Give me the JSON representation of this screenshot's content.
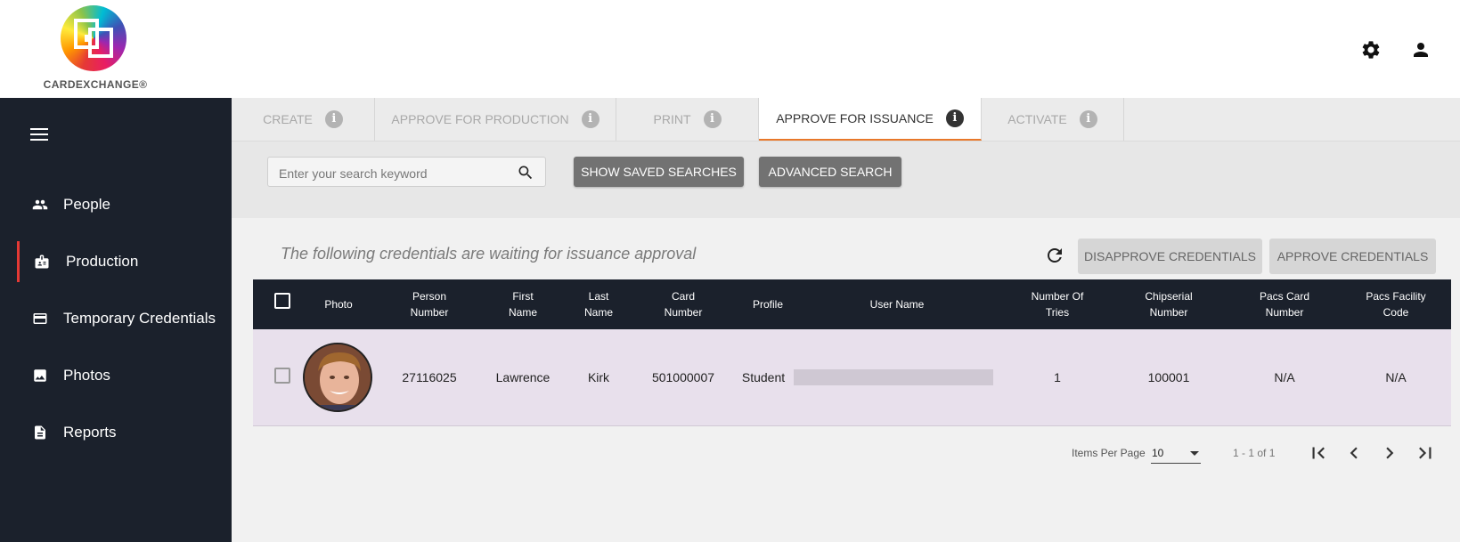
{
  "header": {
    "logo_text": "CARDEXCHANGE®",
    "settings_icon": "gear-icon",
    "account_icon": "person-icon"
  },
  "sidebar": {
    "menu_icon": "hamburger-icon",
    "items": [
      {
        "label": "People",
        "icon": "people-icon"
      },
      {
        "label": "Production",
        "icon": "badge-icon",
        "active": true
      },
      {
        "label": "Temporary Credentials",
        "icon": "card-icon"
      },
      {
        "label": "Photos",
        "icon": "image-icon"
      },
      {
        "label": "Reports",
        "icon": "document-icon"
      }
    ],
    "active_color": "#e53935"
  },
  "tabs": [
    {
      "label": "CREATE"
    },
    {
      "label": "APPROVE FOR PRODUCTION"
    },
    {
      "label": "PRINT"
    },
    {
      "label": "APPROVE FOR ISSUANCE",
      "active": true
    },
    {
      "label": "ACTIVATE"
    }
  ],
  "tab_info_glyph": "i",
  "search": {
    "placeholder": "Enter your search keyword",
    "value": "",
    "show_saved_label": "SHOW SAVED SEARCHES",
    "advanced_label": "ADVANCED SEARCH"
  },
  "section": {
    "title": "The following credentials are waiting for issuance approval",
    "disapprove_label": "DISAPPROVE CREDENTIALS",
    "approve_label": "APPROVE CREDENTIALS"
  },
  "table": {
    "columns": [
      "Photo",
      "Person\nNumber",
      "First\nName",
      "Last\nName",
      "Card\nNumber",
      "Profile",
      "User Name",
      "Number Of\nTries",
      "Chipserial\nNumber",
      "Pacs Card\nNumber",
      "Pacs Facility\nCode"
    ],
    "rows": [
      {
        "person_number": "27116025",
        "first_name": "Lawrence",
        "last_name": "Kirk",
        "card_number": "501000007",
        "profile": "Student",
        "user_name": "",
        "number_of_tries": "1",
        "chipserial_number": "100001",
        "pacs_card_number": "N/A",
        "pacs_facility_code": "N/A"
      }
    ],
    "header_bg": "#1b212c",
    "row_bg": "#e8e0ec"
  },
  "paginator": {
    "items_per_page_label": "Items Per Page",
    "items_per_page_value": "10",
    "range_label": "1 - 1 of 1"
  },
  "colors": {
    "tab_active_underline": "#e8782b",
    "sidebar_bg": "#1b212c"
  }
}
